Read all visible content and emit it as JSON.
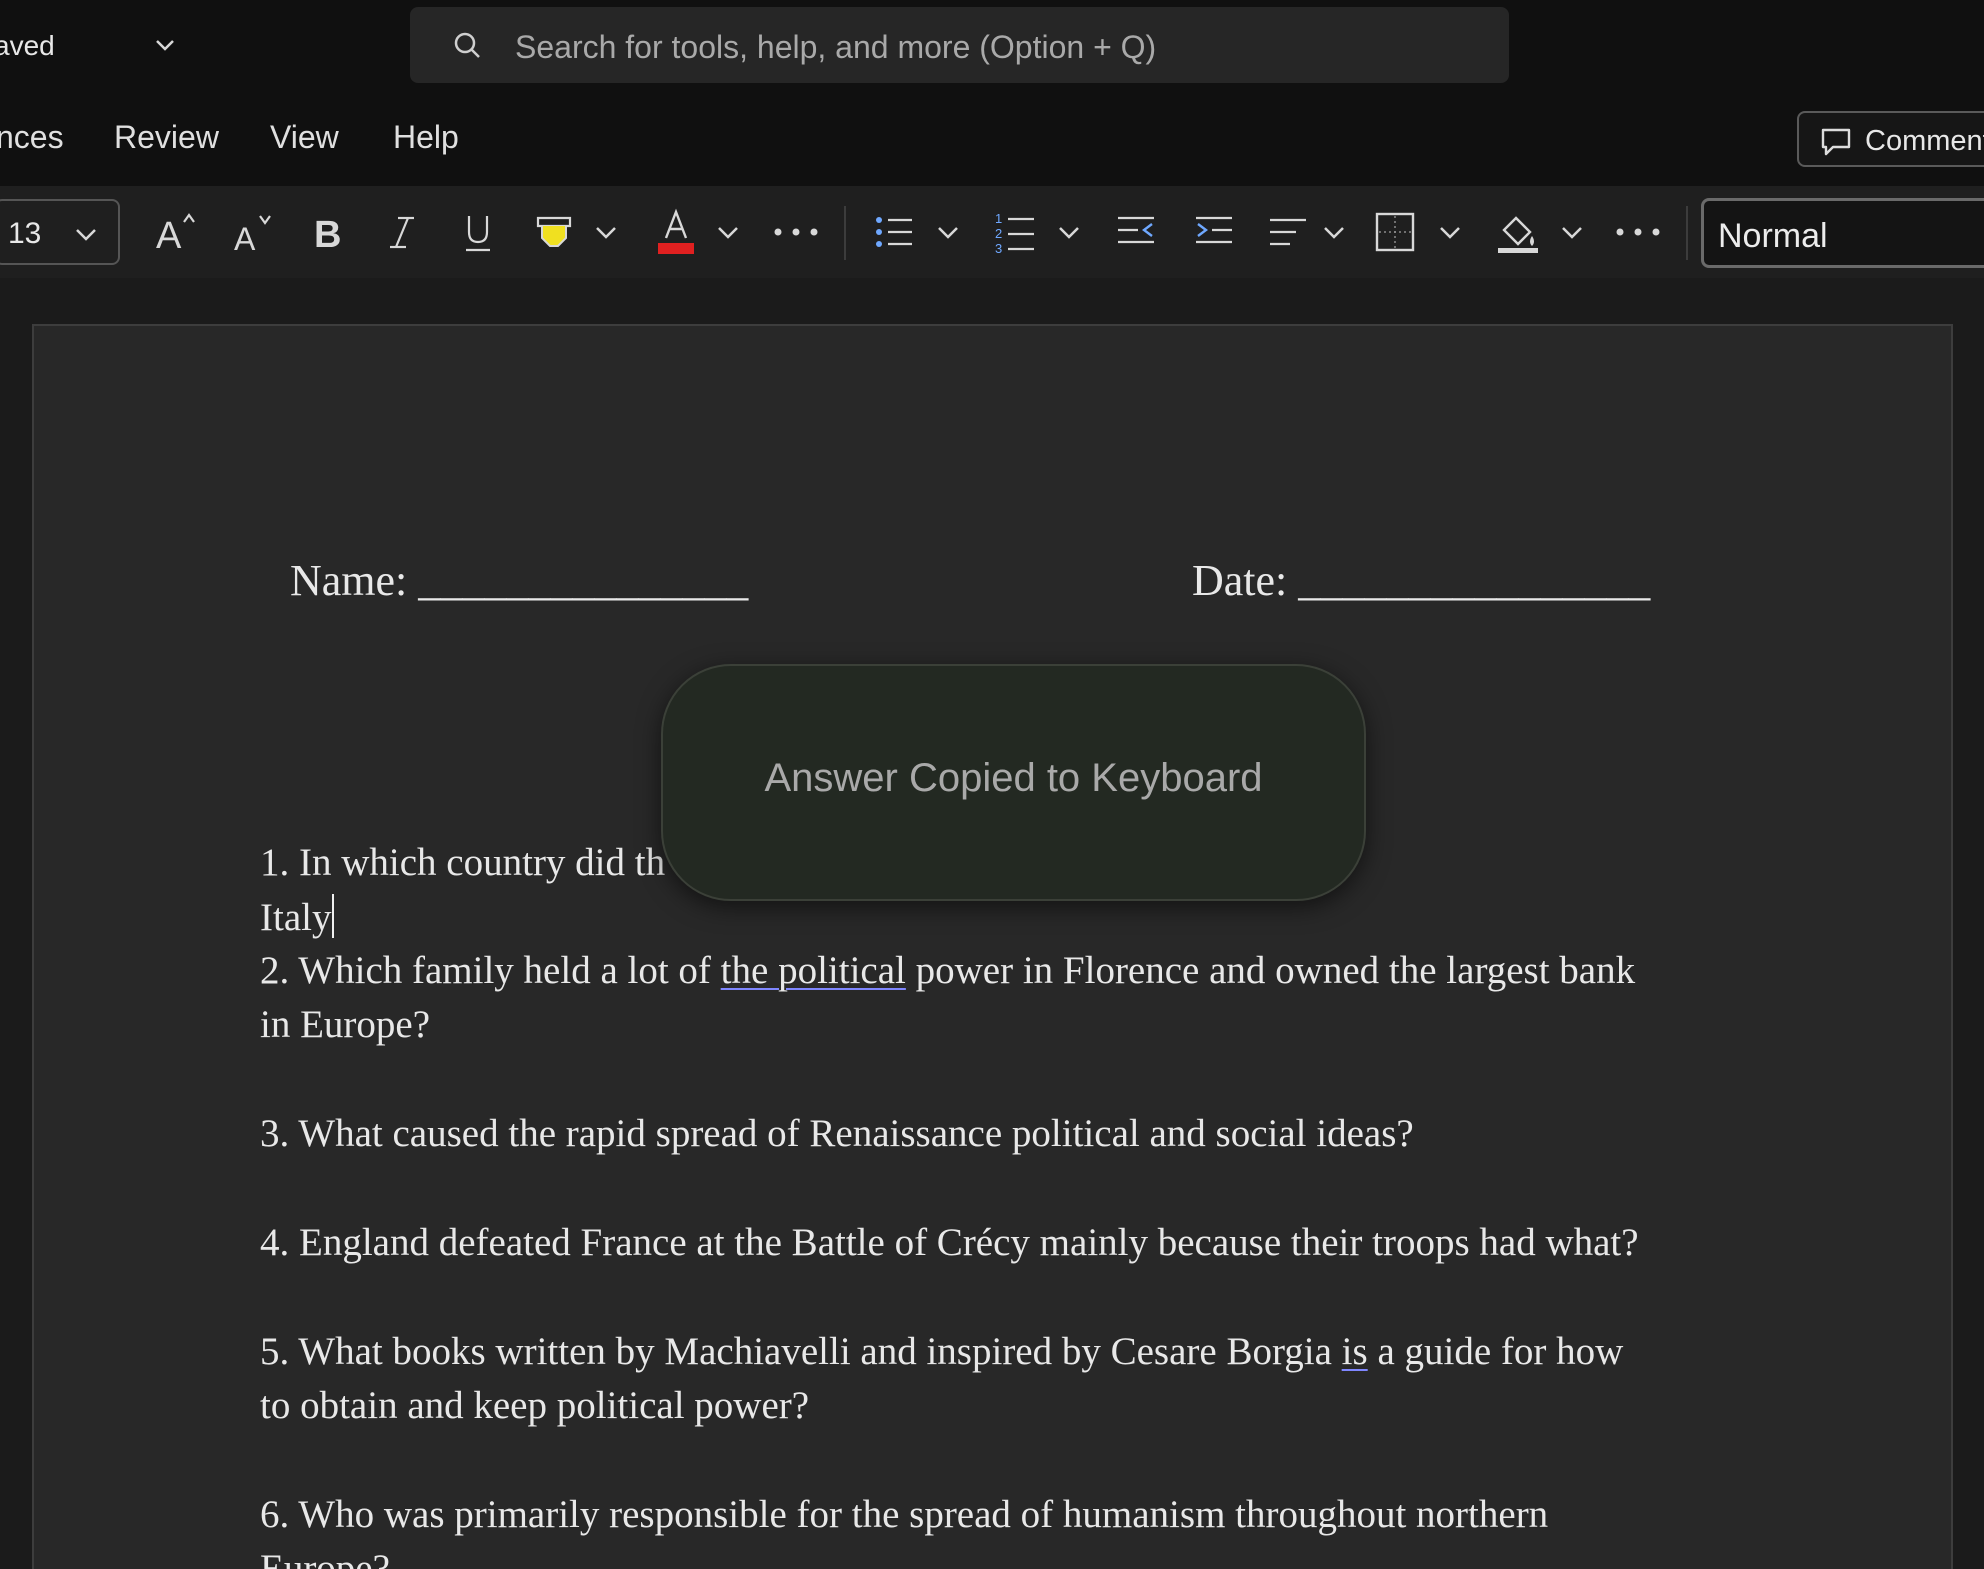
{
  "titlebar": {
    "saved_label": "aved",
    "search_placeholder": "Search for tools, help, and more (Option + Q)"
  },
  "menu": {
    "items": [
      "nces",
      "Review",
      "View",
      "Help"
    ],
    "comments_label": "Comments"
  },
  "ribbon": {
    "font_size": "13",
    "style": "Normal",
    "font_color": "#e02020",
    "highlight_color": "#f0e020"
  },
  "document": {
    "name_label": "Name:",
    "name_blank": "_______________",
    "date_label": "Date:",
    "date_blank": "________________",
    "q1": "1. In which country did th",
    "a1": "Italy",
    "q2_pre": "2. Which family held a lot of ",
    "q2_underlined": "the political",
    "q2_post": " power in Florence and owned the largest bank",
    "q2_line2": "in Europe?",
    "q3": "3. What caused the rapid spread of Renaissance political and social ideas?",
    "q4": "4. England defeated France at the Battle of Crécy mainly because their troops had what?",
    "q5_pre": "5. What books written by Machiavelli and inspired by Cesare Borgia ",
    "q5_underlined": "is",
    "q5_post": " a guide for how",
    "q5_line2": "to obtain and keep political power?",
    "q6": "6. Who was primarily responsible for the spread of humanism throughout northern",
    "q6_line2": "Europe?"
  },
  "toast": {
    "message": "Answer Copied to Keyboard"
  }
}
